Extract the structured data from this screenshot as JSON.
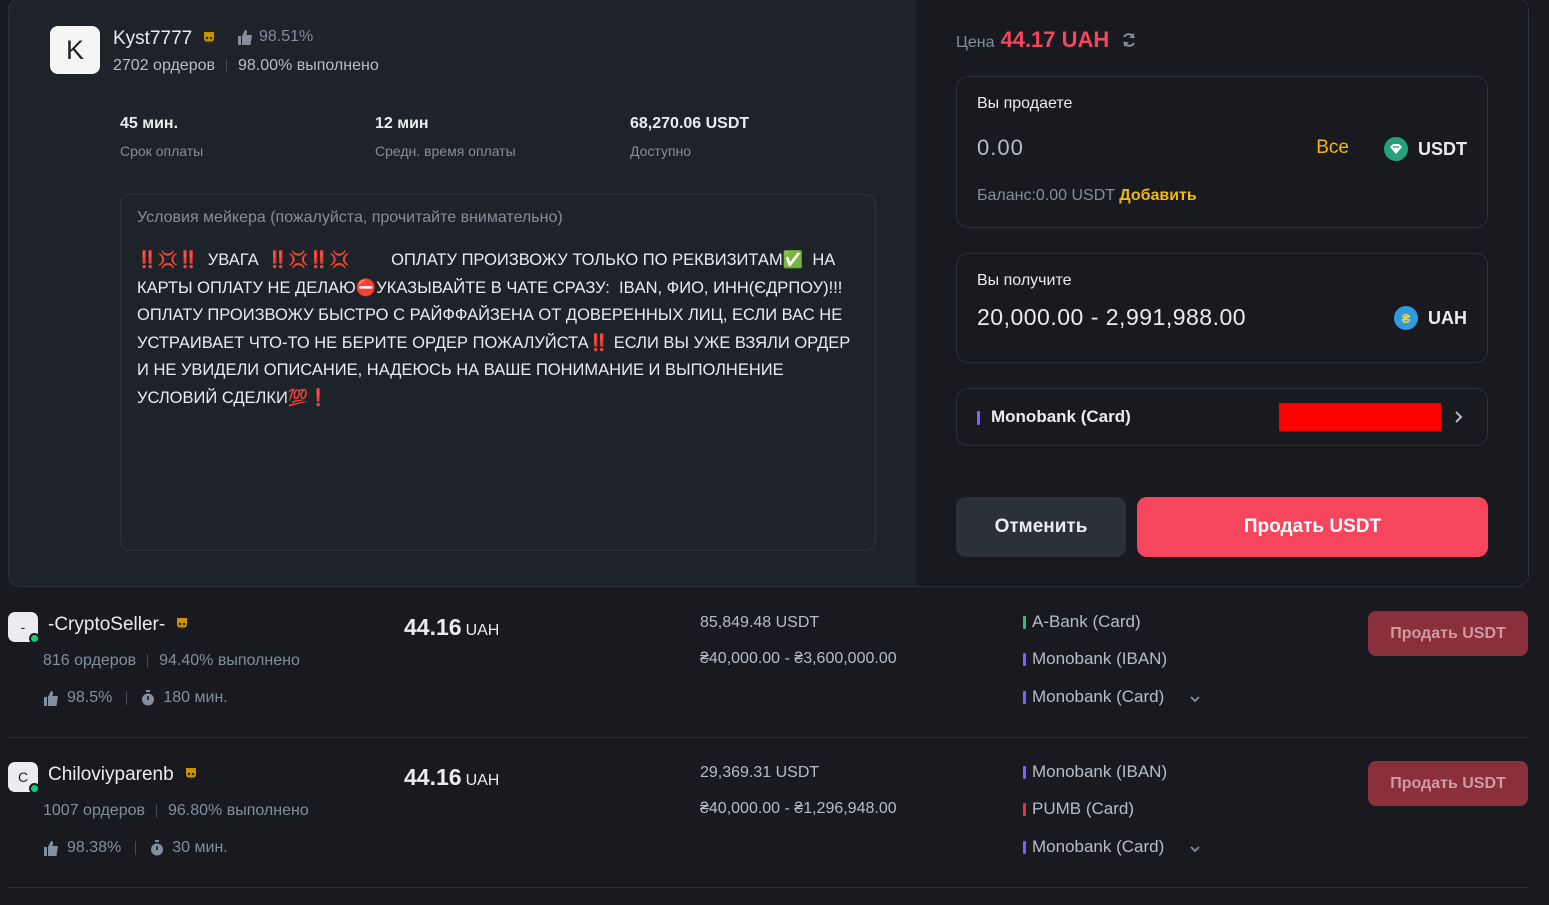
{
  "maker": {
    "avatar_letter": "K",
    "name": "Kyst7777",
    "rating": "98.51%",
    "orders": "2702 ордеров",
    "completion": "98.00% выполнено",
    "metrics": [
      {
        "value": "45 мин.",
        "label": "Срок оплаты"
      },
      {
        "value": "12 мин",
        "label": "Средн. время оплаты"
      },
      {
        "value": "68,270.06 USDT",
        "label": "Доступно"
      }
    ],
    "terms_title": "Условия мейкера (пожалуйста, прочитайте внимательно)",
    "terms_text": "‼️💢‼️  УВАГА  ‼️💢‼️💢         ОПЛАТУ ПРОИЗВОЖУ ТОЛЬКО ПО РЕКВИЗИТАМ✅  НА КАРТЫ ОПЛАТУ НЕ ДЕЛАЮ⛔УКАЗЫВАЙТЕ В ЧАТЕ СРАЗУ:  IBAN, ФИО, ИНН(ЄДРПОУ)!!!     ОПЛАТУ ПРОИЗВОЖУ БЫСТРО С РАЙФФАЙЗЕНА ОТ ДОВЕРЕННЫХ ЛИЦ, ЕСЛИ ВАС НЕ УСТРАИВАЕТ ЧТО-ТО НЕ БЕРИТЕ ОРДЕР ПОЖАЛУЙСТА‼️ ЕСЛИ ВЫ УЖЕ ВЗЯЛИ ОРДЕР И НЕ УВИДЕЛИ ОПИСАНИЕ, НАДЕЮСЬ НА ВАШЕ ПОНИМАНИЕ И ВЫПОЛНЕНИЕ УСЛОВИЙ СДЕЛКИ💯❗"
  },
  "order": {
    "price_label": "Цена",
    "price_value": "44.17 UAH",
    "sell_label": "Вы продаете",
    "sell_amount": "0.00",
    "all_label": "Все",
    "sell_coin": "USDT",
    "balance_label": "Баланс:0.00 USDT",
    "add_label": "Добавить",
    "receive_label": "Вы получите",
    "receive_amount": "20,000.00 - 2,991,988.00",
    "receive_coin": "UAH",
    "receive_coin_symbol": "₴",
    "payment_method": "Monobank (Card)",
    "cancel_label": "Отменить",
    "sell_button": "Продать USDT"
  },
  "colors": {
    "accent_red": "#f6465d",
    "accent_yellow": "#f0b90b",
    "usdt_green": "#26a17b",
    "uah_blue": "#2f9bdf"
  },
  "ads": [
    {
      "avatar_letter": "-",
      "name": "-CryptoSeller-",
      "orders": "816 ордеров",
      "completion": "94.40% выполнено",
      "rating": "98.5%",
      "time": "180 мин.",
      "price": "44.16",
      "currency": "UAH",
      "available": "85,849.48 USDT",
      "limit": "₴40,000.00 - ₴3,600,000.00",
      "methods": [
        {
          "name": "A-Bank (Card)",
          "color": "#2ebd85"
        },
        {
          "name": "Monobank (IBAN)",
          "color": "#7b61ff"
        },
        {
          "name": "Monobank (Card)",
          "color": "#7b61ff"
        }
      ],
      "button": "Продать USDT"
    },
    {
      "avatar_letter": "C",
      "name": "Chiloviyparenb",
      "orders": "1007 ордеров",
      "completion": "96.80% выполнено",
      "rating": "98.38%",
      "time": "30 мин.",
      "price": "44.16",
      "currency": "UAH",
      "available": "29,369.31 USDT",
      "limit": "₴40,000.00 - ₴1,296,948.00",
      "methods": [
        {
          "name": "Monobank (IBAN)",
          "color": "#7b61ff"
        },
        {
          "name": "PUMB (Card)",
          "color": "#e0364b"
        },
        {
          "name": "Monobank (Card)",
          "color": "#7b61ff"
        }
      ],
      "button": "Продать USDT"
    }
  ]
}
